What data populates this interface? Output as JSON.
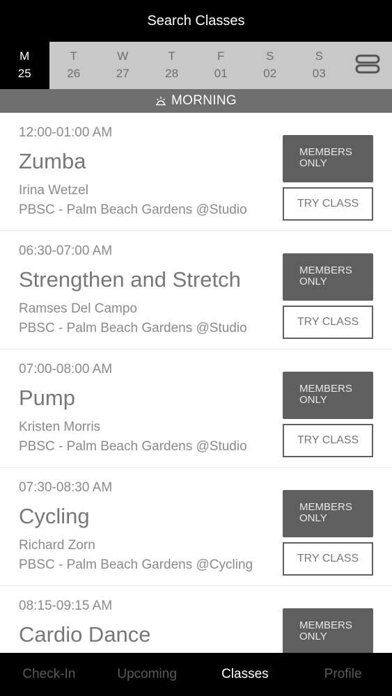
{
  "header": {
    "title": "Search Classes"
  },
  "days": [
    {
      "dow": "M",
      "num": "25",
      "selected": true
    },
    {
      "dow": "T",
      "num": "26",
      "selected": false
    },
    {
      "dow": "W",
      "num": "27",
      "selected": false
    },
    {
      "dow": "T",
      "num": "28",
      "selected": false
    },
    {
      "dow": "F",
      "num": "01",
      "selected": false
    },
    {
      "dow": "S",
      "num": "02",
      "selected": false
    },
    {
      "dow": "S",
      "num": "03",
      "selected": false
    }
  ],
  "view_toggle_icon": "list-toggle-icon",
  "section": {
    "label": "MORNING",
    "icon": "sun-icon"
  },
  "buttons": {
    "members": "MEMBERS\nONLY",
    "try": "TRY CLASS"
  },
  "classes": [
    {
      "time": "12:00-01:00 AM",
      "name": "Zumba",
      "instructor": "Irina Wetzel",
      "location": "PBSC - Palm Beach Gardens @Studio"
    },
    {
      "time": "06:30-07:00 AM",
      "name": "Strengthen and Stretch",
      "instructor": "Ramses Del Campo",
      "location": "PBSC - Palm Beach Gardens @Studio"
    },
    {
      "time": "07:00-08:00 AM",
      "name": "Pump",
      "instructor": "Kristen Morris",
      "location": "PBSC - Palm Beach Gardens @Studio"
    },
    {
      "time": "07:30-08:30 AM",
      "name": "Cycling",
      "instructor": "Richard Zorn",
      "location": "PBSC - Palm Beach Gardens @Cycling"
    },
    {
      "time": "08:15-09:15 AM",
      "name": "Cardio Dance",
      "instructor": "",
      "location": ""
    }
  ],
  "tabs": [
    {
      "label": "Check-In",
      "active": false
    },
    {
      "label": "Upcoming",
      "active": false
    },
    {
      "label": "Classes",
      "active": true
    },
    {
      "label": "Profile",
      "active": false
    }
  ],
  "colors": {
    "selected_day": "#000000",
    "strip": "#c8c8c8",
    "section": "#6e6e6e",
    "button": "#5f5f5f"
  }
}
